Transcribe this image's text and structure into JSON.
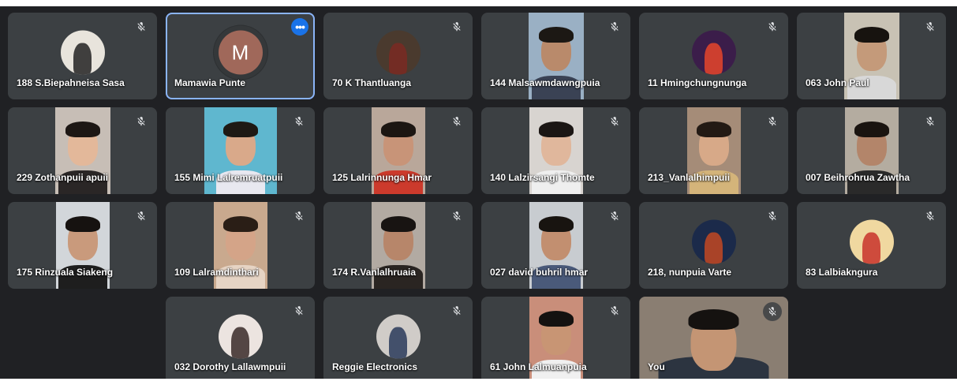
{
  "tiles": [
    {
      "name": "188 S.Biepahneisa Sasa",
      "kind": "avatar",
      "avatar_bg": "#e8e4dc",
      "avatar_fg": "#222222",
      "muted": true
    },
    {
      "name": "Mamawia Punte",
      "kind": "letter",
      "letter": "M",
      "letter_bg": "#a0685a",
      "active": true,
      "more": "•••"
    },
    {
      "name": "70 K Thantluanga",
      "kind": "avatar",
      "avatar_bg": "#4a3a2e",
      "avatar_fg": "#7a2a22",
      "muted": true
    },
    {
      "name": "144 Malsawmdawngpuia",
      "kind": "video",
      "video_bg": "#9ab0c4",
      "skin": "#b98a6b",
      "hair": "#1c1814",
      "cloth": "#3a4254",
      "vw": 70,
      "muted": true
    },
    {
      "name": "11 Hmingchungnunga",
      "kind": "avatar",
      "avatar_bg": "#3b1d4a",
      "avatar_fg": "#e8452a",
      "muted": true
    },
    {
      "name": "063 John Paul",
      "kind": "video",
      "video_bg": "#c8c2b4",
      "skin": "#c49a7a",
      "hair": "#17130f",
      "cloth": "#d8d8d8",
      "vw": 70,
      "muted": true
    },
    {
      "name": "229 Zothanpuii apuii",
      "kind": "video",
      "video_bg": "#c7beb6",
      "skin": "#e3b89a",
      "hair": "#1d1714",
      "cloth": "#2a2626",
      "vw": 70,
      "muted": true
    },
    {
      "name": "155 Mimi Lalremruatpuii",
      "kind": "video",
      "video_bg": "#5fb7cf",
      "skin": "#d9a98a",
      "hair": "#1e1914",
      "cloth": "#e8e8f0",
      "vw": 92,
      "muted": true
    },
    {
      "name": "125 Lalrinnunga Hmar",
      "kind": "video",
      "video_bg": "#b9a79a",
      "skin": "#c89478",
      "hair": "#1c1612",
      "cloth": "#cc3a2c",
      "vw": 68,
      "muted": true
    },
    {
      "name": "140 Lalzirsangi Thomte",
      "kind": "video",
      "video_bg": "#d8d4d0",
      "skin": "#e0b79c",
      "hair": "#1b1614",
      "cloth": "#efefef",
      "vw": 68,
      "muted": true
    },
    {
      "name": "213_Vanlalhimpuii",
      "kind": "video",
      "video_bg": "#a58c78",
      "skin": "#d7a988",
      "hair": "#231a14",
      "cloth": "#d4b47a",
      "vw": 68,
      "muted": true
    },
    {
      "name": "007 Beihrohrua Zawtha",
      "kind": "video",
      "video_bg": "#b4aca0",
      "skin": "#b3856a",
      "hair": "#1a1410",
      "cloth": "#2a2a2a",
      "vw": 68,
      "muted": true
    },
    {
      "name": "175 Rinzuala Siakeng",
      "kind": "video",
      "video_bg": "#d2d6da",
      "skin": "#c99a7c",
      "hair": "#161210",
      "cloth": "#1e1e1e",
      "vw": 68,
      "muted": true
    },
    {
      "name": "109 Lalramdinthari",
      "kind": "video",
      "video_bg": "#c9a98e",
      "skin": "#d4a488",
      "hair": "#2a1e16",
      "cloth": "#e6d4c4",
      "vw": 68,
      "muted": true
    },
    {
      "name": "174 R.Vanlalhruaia",
      "kind": "video",
      "video_bg": "#b2aaa2",
      "skin": "#b7866a",
      "hair": "#181412",
      "cloth": "#2a2522",
      "vw": 68,
      "muted": true
    },
    {
      "name": "027 david buhril hmar",
      "kind": "video",
      "video_bg": "#c8ccd0",
      "skin": "#c28f70",
      "hair": "#181410",
      "cloth": "#4a5a7a",
      "vw": 68,
      "muted": true
    },
    {
      "name": "218, nunpuia Varte",
      "kind": "avatar",
      "avatar_bg": "#1b2a4a",
      "avatar_fg": "#c24822",
      "muted": true
    },
    {
      "name": "83 Lalbiakngura",
      "kind": "avatar",
      "avatar_bg": "#f0d8a0",
      "avatar_fg": "#c8322a",
      "muted": true
    },
    {
      "kind": "blank"
    },
    {
      "name": "032 Dorothy Lallawmpuii",
      "kind": "avatar",
      "avatar_bg": "#ece4e0",
      "avatar_fg": "#3a2a28",
      "muted": true
    },
    {
      "name": "Reggie Electronics",
      "kind": "avatar",
      "avatar_bg": "#d0ccc8",
      "avatar_fg": "#2a3a5a",
      "muted": true
    },
    {
      "name": "61 John Lalmuanpuia",
      "kind": "video",
      "video_bg": "#c98e7a",
      "skin": "#c89574",
      "hair": "#141210",
      "cloth": "#f0f0f0",
      "vw": 68,
      "muted": true
    },
    {
      "name": "You",
      "kind": "video",
      "video_bg": "#8a7e72",
      "skin": "#c49574",
      "hair": "#151210",
      "cloth": "#2c3440",
      "vw": 189,
      "muted": true,
      "mic_bubble": true
    },
    {
      "kind": "blank"
    }
  ]
}
